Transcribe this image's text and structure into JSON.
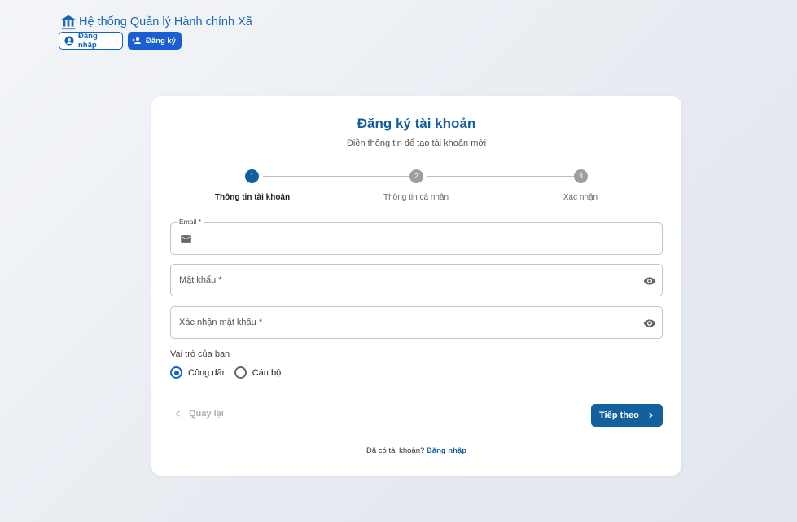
{
  "header": {
    "brand_title": "Hệ thống Quản lý Hành chính Xã",
    "login_label": "Đăng nhập",
    "register_label": "Đăng ký"
  },
  "card": {
    "title": "Đăng ký tài khoản",
    "subtitle": "Điền thông tin để tạo tài khoản mới"
  },
  "stepper": {
    "active_step": 1,
    "steps": [
      {
        "number": "1",
        "label": "Thông tin tài khoản"
      },
      {
        "number": "2",
        "label": "Thông tin cá nhân"
      },
      {
        "number": "3",
        "label": "Xác nhận"
      }
    ]
  },
  "form": {
    "email_label": "Email *",
    "email_value": "",
    "password_placeholder": "Mật khẩu *",
    "confirm_password_placeholder": "Xác nhận mật khẩu *",
    "role_label": "Vai trò của bạn",
    "roles": [
      {
        "label": "Công dân",
        "selected": true
      },
      {
        "label": "Cán bộ",
        "selected": false
      }
    ],
    "back_label": "Quay lại",
    "next_label": "Tiếp theo"
  },
  "footer": {
    "prompt": "Đã có tài khoản?",
    "login_link": "Đăng nhập"
  },
  "colors": {
    "primary": "#155fa0",
    "brand": "#1a65b3",
    "register_button": "#1a5fd1",
    "inactive_step": "#9e9e9e"
  },
  "icons": {
    "brand": "bank-icon",
    "login": "account-circle-icon",
    "register": "person-add-icon",
    "email": "mail-icon",
    "password_toggle": "eye-icon",
    "back": "chevron-left-icon",
    "next": "chevron-right-icon"
  }
}
